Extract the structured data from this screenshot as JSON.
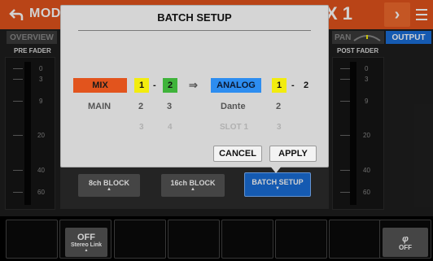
{
  "header": {
    "title_left": "MODU",
    "title_right": "X 1",
    "back_icon": "back-arrow-icon",
    "next_icon": "chevron-right-icon",
    "menu_icon": "menu-icon"
  },
  "tabs": {
    "overview": "OVERVIEW",
    "pan": "PAN",
    "output": "OUTPUT"
  },
  "faders": {
    "pre_label": "PRE FADER",
    "post_label": "POST FADER",
    "ticks": [
      "0",
      "3",
      "9",
      "20",
      "40",
      "60"
    ]
  },
  "dialog": {
    "title": "BATCH SETUP",
    "source_label": "MIX",
    "source_from": "1",
    "source_dash": "-",
    "source_to": "2",
    "arrow": "⇒",
    "dest_label": "ANALOG",
    "dest_from": "1",
    "dest_dash": "-",
    "dest_to": "2",
    "row2_left": "MAIN",
    "row2_a": "2",
    "row2_b": "3",
    "row2_dest": "Dante",
    "row2_dest_num": "2",
    "row3_a": "3",
    "row3_b": "4",
    "row3_dest": "SLOT 1",
    "row3_dest_num": "3",
    "cancel": "CANCEL",
    "apply": "APPLY"
  },
  "blocks": {
    "b8": "8ch BLOCK",
    "b16": "16ch BLOCK",
    "batch": "BATCH SETUP"
  },
  "bottom": {
    "off_label": "OFF",
    "stereo_link": "Stereo Link",
    "phase_symbol": "φ",
    "phase_state": "OFF"
  },
  "colors": {
    "accent_orange": "#e2541d",
    "accent_blue": "#1a6ed8",
    "yellow": "#f2ec0e",
    "green": "#3fb33a"
  }
}
